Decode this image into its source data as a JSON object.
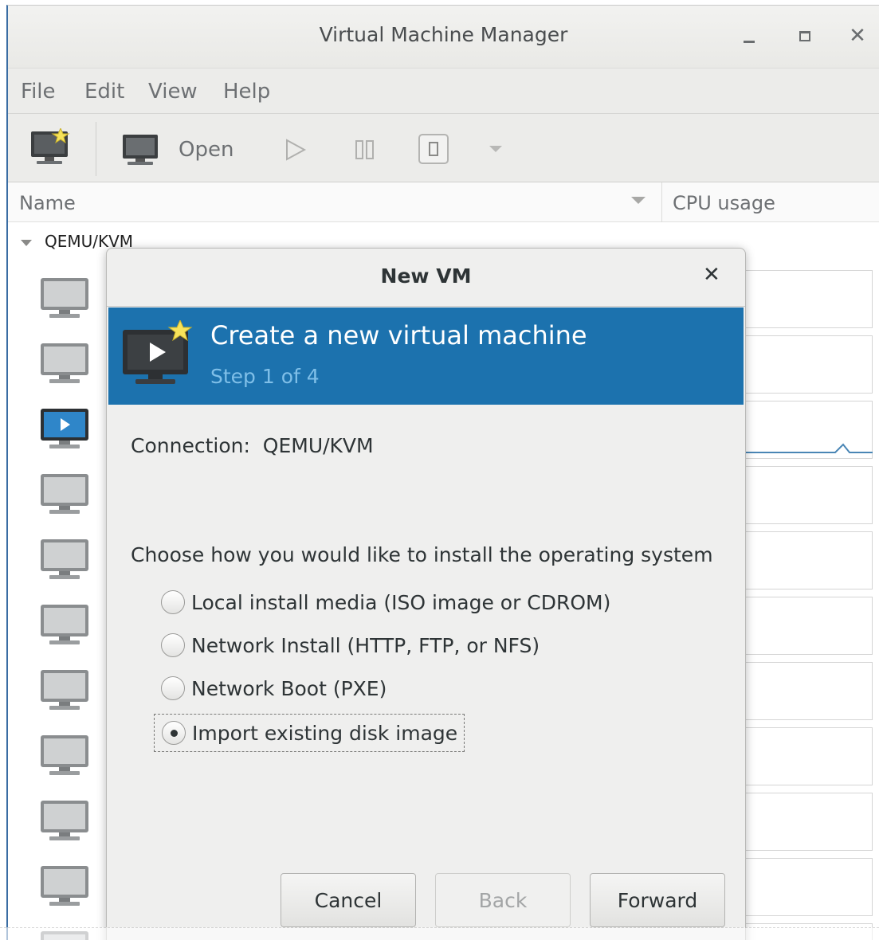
{
  "window": {
    "title": "Virtual Machine Manager"
  },
  "menubar": {
    "items": [
      "File",
      "Edit",
      "View",
      "Help"
    ]
  },
  "toolbar": {
    "open_label": "Open",
    "icons": [
      "new-vm-icon",
      "open-monitor-icon",
      "run-icon",
      "pause-icon",
      "shutdown-icon",
      "shutdown-menu-icon"
    ]
  },
  "list": {
    "columns": [
      "Name",
      "CPU usage"
    ],
    "group": "QEMU/KVM",
    "vm_count_visible": 11
  },
  "dialog": {
    "title": "New VM",
    "banner_title": "Create a new virtual machine",
    "banner_step": "Step 1 of 4",
    "connection": "Connection:  QEMU/KVM",
    "prompt": "Choose how you would like to install the operating system",
    "options": [
      "Local install media (ISO image or CDROM)",
      "Network Install (HTTP, FTP, or NFS)",
      "Network Boot (PXE)",
      "Import existing disk image"
    ],
    "selected_option": "Import existing disk image",
    "buttons": {
      "cancel": "Cancel",
      "back": "Back",
      "forward": "Forward"
    }
  },
  "colors": {
    "banner": "#1c72ae",
    "banner_step": "#7fbfe8",
    "window_border": "#3a6da3"
  }
}
